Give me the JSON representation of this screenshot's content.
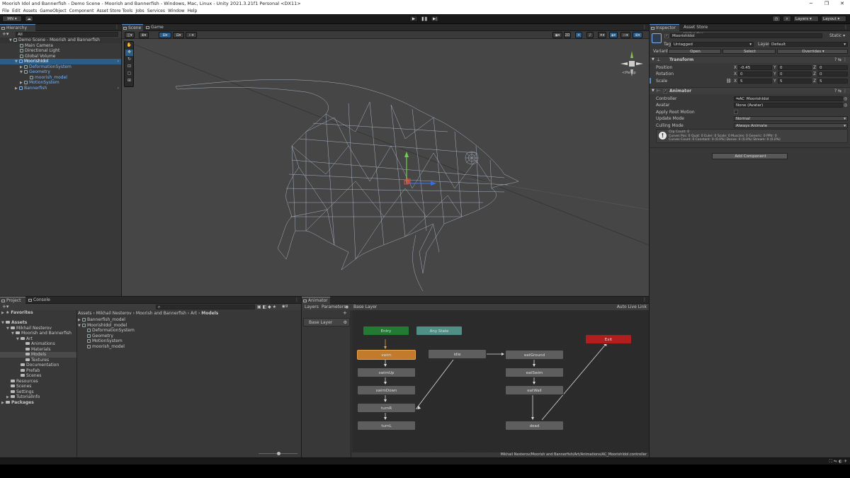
{
  "window": {
    "title": "Moorish Idol and Bannerfish - Demo Scene - Moorish and Bannerfish - Windows, Mac, Linux - Unity 2021.3.21f1 Personal <DX11>"
  },
  "menu": [
    "File",
    "Edit",
    "Assets",
    "GameObject",
    "Component",
    "Asset Store Tools",
    "Jobs",
    "Services",
    "Window",
    "Help"
  ],
  "toolbar": {
    "account": "MN",
    "layers": "Layers",
    "layout": "Layout"
  },
  "hierarchy": {
    "tab": "Hierarchy",
    "search_placeholder": "All",
    "items": [
      {
        "label": "Demo Scene - Moorish and Bannerfish"
      },
      {
        "label": "Main Camera"
      },
      {
        "label": "Directional Light"
      },
      {
        "label": "Global Volume"
      },
      {
        "label": "MoorishIdol"
      },
      {
        "label": "DeformationSystem"
      },
      {
        "label": "Geometry"
      },
      {
        "label": "moorish_model"
      },
      {
        "label": "MotionSystem"
      },
      {
        "label": "Bannerfish"
      }
    ]
  },
  "scene": {
    "tabs": [
      "Scene",
      "Game"
    ],
    "mode_2d": "2D",
    "persp": "<Persp"
  },
  "inspector": {
    "tabs": [
      "Inspector",
      "Asset Store Uploader"
    ],
    "object_name": "MoorishIdol",
    "static_label": "Static",
    "tag_label": "Tag",
    "tag_value": "Untagged",
    "layer_label": "Layer",
    "layer_value": "Default",
    "variant_label": "Variant",
    "open_btn": "Open",
    "select_btn": "Select",
    "overrides_btn": "Overrides",
    "transform": {
      "title": "Transform",
      "position_label": "Position",
      "rotation_label": "Rotation",
      "scale_label": "Scale",
      "position": {
        "x": "-0.45",
        "y": "0",
        "z": "0"
      },
      "rotation": {
        "x": "0",
        "y": "0",
        "z": "0"
      },
      "scale": {
        "x": "5",
        "y": "5",
        "z": "5"
      }
    },
    "animator": {
      "title": "Animator",
      "controller_label": "Controller",
      "controller_value": "AC_MoorishIdol",
      "avatar_label": "Avatar",
      "avatar_value": "None (Avatar)",
      "root_motion_label": "Apply Root Motion",
      "update_label": "Update Mode",
      "update_value": "Normal",
      "culling_label": "Culling Mode",
      "culling_value": "Always Animate",
      "info_line1": "Clip Count: 0",
      "info_line2": "Curves Pos: 0 Quat: 0 Euler: 0 Scale: 0 Muscles: 0 Generic: 0 PPtr: 0",
      "info_line3": "Curves Count: 0 Constant: 0 (0.0%) Dense: 0 (0.0%) Stream: 0 (0.0%)"
    },
    "add_component": "Add Component"
  },
  "project": {
    "tabs": [
      "Project",
      "Console"
    ],
    "favorites": "Favorites",
    "tree": [
      {
        "label": "Assets"
      },
      {
        "label": "Mikhail Nesterov"
      },
      {
        "label": "Moorish and Bannerfish"
      },
      {
        "label": "Art"
      },
      {
        "label": "Animations"
      },
      {
        "label": "Materials"
      },
      {
        "label": "Models"
      },
      {
        "label": "Textures"
      },
      {
        "label": "Documentation"
      },
      {
        "label": "Prefab"
      },
      {
        "label": "Scenes"
      },
      {
        "label": "Resources"
      },
      {
        "label": "Scenes"
      },
      {
        "label": "Settings"
      },
      {
        "label": "TutorialInfo"
      },
      {
        "label": "Packages"
      }
    ],
    "breadcrumb": [
      "Assets",
      "Mikhail Nesterov",
      "Moorish and Bannerfish",
      "Art",
      "Models"
    ],
    "files": [
      {
        "label": "Bannerfish_model"
      },
      {
        "label": "MoorishIdol_model"
      },
      {
        "label": "DeformationSystem"
      },
      {
        "label": "Geometry"
      },
      {
        "label": "MotionSystem"
      },
      {
        "label": "moorish_model"
      }
    ],
    "count": "9"
  },
  "animator_window": {
    "tab": "Animator",
    "subtabs": [
      "Layers",
      "Parameters"
    ],
    "layer_crumb": "Base Layer",
    "auto_live_link": "Auto Live Link",
    "layer_item": "Base Layer",
    "path": "Mikhail Nesterov/Moorish and Bannerfish/Art/Animations/AC_MoorishIdol.controller",
    "states": [
      {
        "label": "Entry"
      },
      {
        "label": "Any State"
      },
      {
        "label": "Exit"
      },
      {
        "label": "swim"
      },
      {
        "label": "swimUp"
      },
      {
        "label": "swimDown"
      },
      {
        "label": "turnR"
      },
      {
        "label": "turnL"
      },
      {
        "label": "idle"
      },
      {
        "label": "eatGround"
      },
      {
        "label": "eatSwim"
      },
      {
        "label": "eatWall"
      },
      {
        "label": "dead"
      }
    ]
  },
  "colors": {
    "accent": "#2c5d87",
    "prefab_blue": "#7cb4f5",
    "entry": "#237a33",
    "any_state": "#4f8f86",
    "exit": "#b21e1e",
    "default_state": "#c27a2c"
  }
}
